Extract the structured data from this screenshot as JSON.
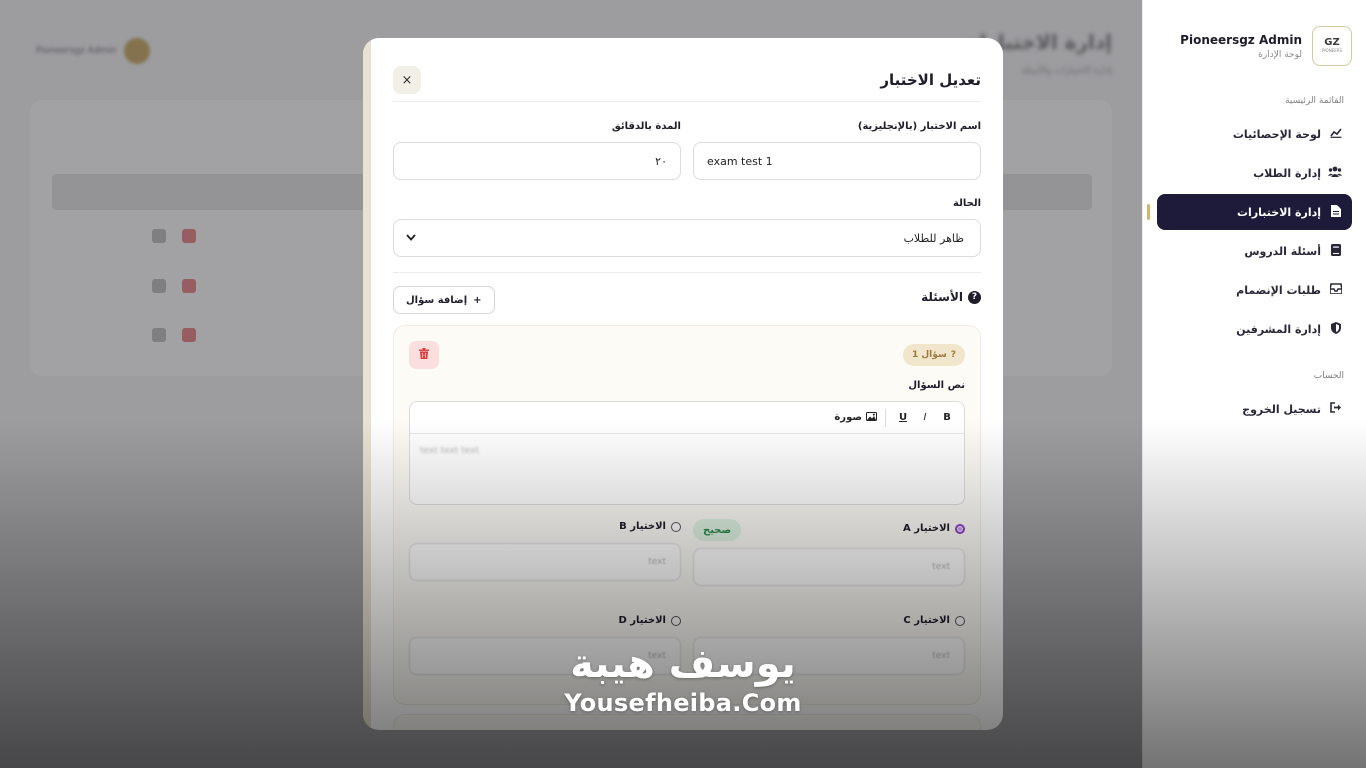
{
  "sidebar": {
    "brand_title": "Pioneersgz Admin",
    "brand_subtitle": "لوحة الإدارة",
    "logo_text": "GZ",
    "logo_sub": "PIONEERS",
    "main_section_label": "القائمة الرئيسية",
    "items": [
      {
        "label": "لوحة الإحصائيات",
        "icon": "chart-icon",
        "glyph": "📈"
      },
      {
        "label": "إدارة الطلاب",
        "icon": "users-icon",
        "glyph": "👥"
      },
      {
        "label": "إدارة الاختبارات",
        "icon": "file-icon",
        "glyph": "📄",
        "active": true
      },
      {
        "label": "أسئلة الدروس",
        "icon": "book-icon",
        "glyph": "📘"
      },
      {
        "label": "طلبات الإنضمام",
        "icon": "inbox-icon",
        "glyph": "📥"
      },
      {
        "label": "إدارة المشرفين",
        "icon": "shield-icon",
        "glyph": "🛡"
      }
    ],
    "account_section_label": "الحساب",
    "logout_label": "تسجيل الخروج"
  },
  "modal": {
    "title": "تعديل الاختبار",
    "close_glyph": "×",
    "name_label": "اسم الاختبار (بالإنجليزية)",
    "name_value": "exam test 1",
    "duration_label": "المدة بالدقائق",
    "duration_value": "٢٠",
    "status_label": "الحالة",
    "status_value": "ظاهر للطلاب",
    "questions_label": "الأسئلة",
    "add_question_label": "إضافة سؤال",
    "question": {
      "badge": "سؤال 1",
      "text_label": "نص السؤال",
      "toolbar": {
        "bold": "B",
        "italic": "I",
        "underline": "U",
        "image": "صورة"
      },
      "placeholder_blurred": "text text text",
      "options": [
        {
          "label": "الاختيار A",
          "checked": true,
          "value": "text"
        },
        {
          "label": "الاختيار B",
          "checked": false,
          "value": "text"
        },
        {
          "label": "الاختيار C",
          "checked": false,
          "value": "text"
        },
        {
          "label": "الاختيار D",
          "checked": false,
          "value": "text"
        }
      ],
      "correct_label": "صحيح"
    }
  },
  "watermark": {
    "arabic": "يوسف هيبة",
    "english": "Yousefheiba.Com"
  },
  "colors": {
    "accent_dark": "#1e1b3a",
    "accent_gold": "#d8b46a",
    "danger": "#d93b3b",
    "success": "#2d8b48",
    "radio_checked": "#8e3fc5"
  }
}
